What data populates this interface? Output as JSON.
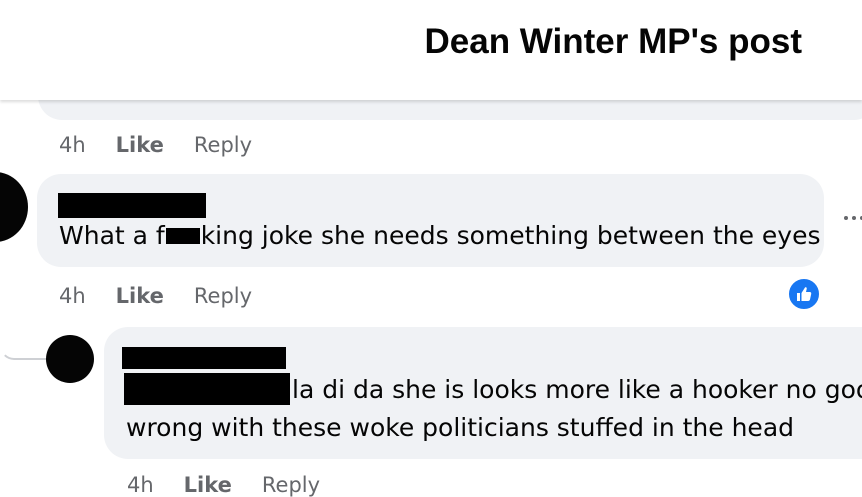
{
  "header": {
    "title": "Dean Winter MP's post"
  },
  "comments": [
    {
      "text": "",
      "time": "4h",
      "like": "Like",
      "reply": "Reply"
    },
    {
      "text_before": "What a f",
      "text_after": "king joke she needs something between the eyes",
      "time": "4h",
      "like": "Like",
      "reply": "Reply"
    },
    {
      "line1": "la di da she is looks more like a hooker no goo",
      "line2": "wrong with these woke politicians stuffed in the head",
      "time": "4h",
      "like": "Like",
      "reply": "Reply"
    }
  ],
  "icons": {
    "like_badge": "thumbs-up-icon",
    "more": "more-options-icon"
  },
  "colors": {
    "accent": "#1877f2",
    "bubble": "#f0f2f5",
    "meta": "#65676b"
  }
}
